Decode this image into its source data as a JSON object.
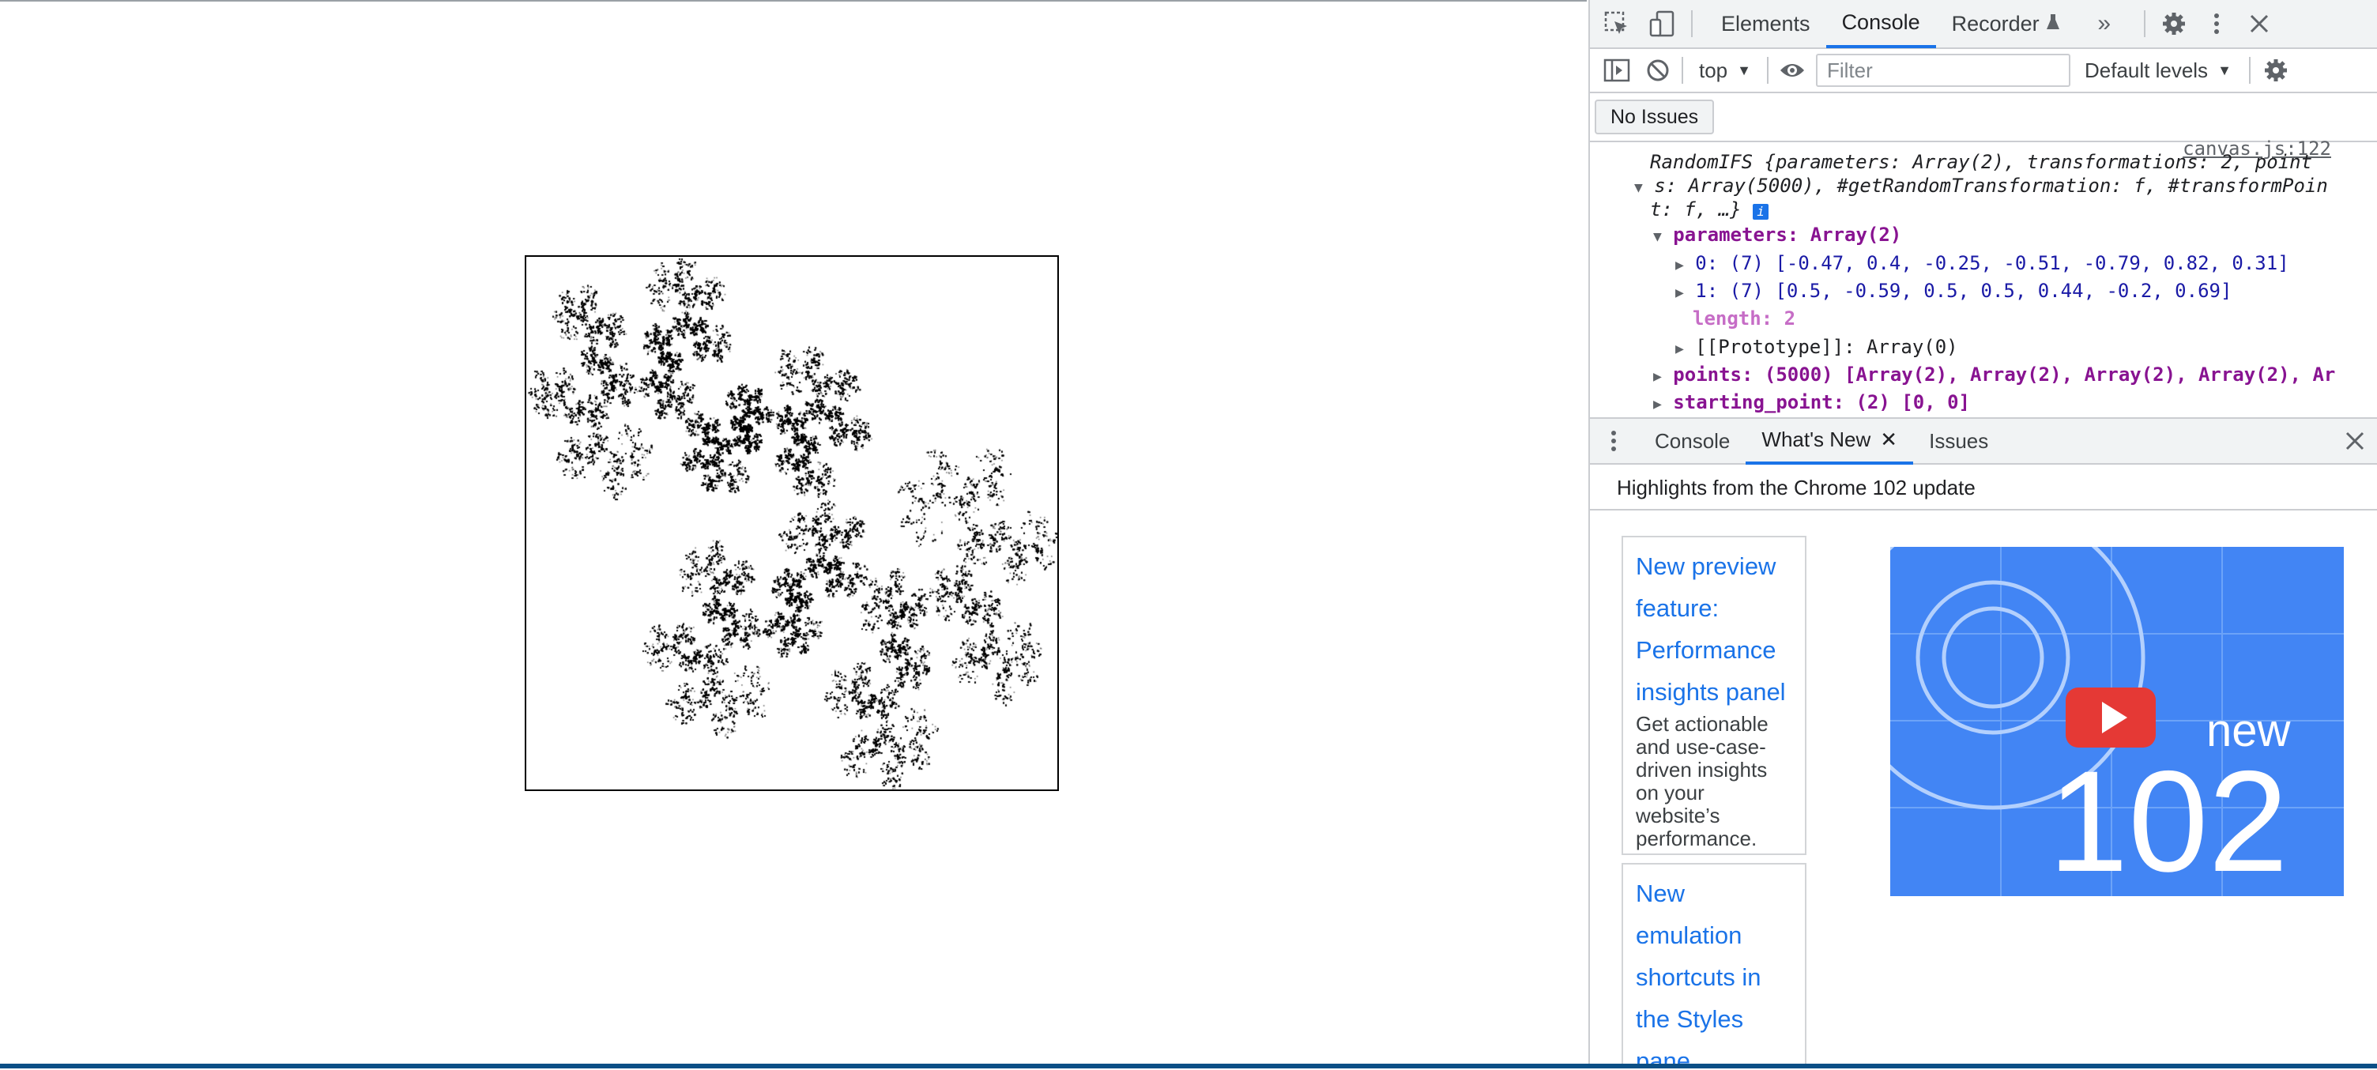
{
  "devtools": {
    "main_tabs": [
      "Elements",
      "Console",
      "Recorder"
    ],
    "console_toolbar": {
      "context": "top",
      "filter_placeholder": "Filter",
      "levels": "Default levels"
    },
    "issues_button": "No Issues",
    "console": {
      "source_link": "canvas.js:122",
      "lines": [
        "RandomIFS {parameters: Array(2), transformations: 2, point",
        "s: Array(5000), #getRandomTransformation: f, #transformPoin",
        "t: f, …}",
        "parameters: Array(2)",
        "0: (7) [-0.47, 0.4, -0.25, -0.51, -0.79, 0.82, 0.31]",
        "1: (7) [0.5, -0.59, 0.5, 0.5, 0.44, -0.2, 0.69]",
        "length: 2",
        "[[Prototype]]: Array(0)",
        "points: (5000) [Array(2), Array(2), Array(2), Array(2), Ar",
        "starting_point: (2) [0, 0]"
      ],
      "info_badge": "i"
    },
    "drawer_tabs": [
      "Console",
      "What's New",
      "Issues"
    ],
    "whats_new": {
      "highlights": "Highlights from the Chrome 102 update",
      "cards": [
        {
          "title": "New preview feature: Performance insights panel",
          "desc": "Get actionable and use-case-driven insights on your website’s performance."
        },
        {
          "title": "New emulation shortcuts in the Styles pane",
          "desc": ""
        }
      ],
      "video": {
        "label": "new",
        "number": "102"
      }
    }
  },
  "canvas": {
    "description_hidden": "",
    "parameters": [
      [
        -0.47,
        0.4,
        -0.25,
        -0.51,
        -0.79,
        0.82,
        0.31
      ],
      [
        0.5,
        -0.59,
        0.5,
        0.5,
        0.44,
        -0.2,
        0.69
      ]
    ],
    "point_count": 5000,
    "starting_point": [
      0,
      0
    ]
  }
}
